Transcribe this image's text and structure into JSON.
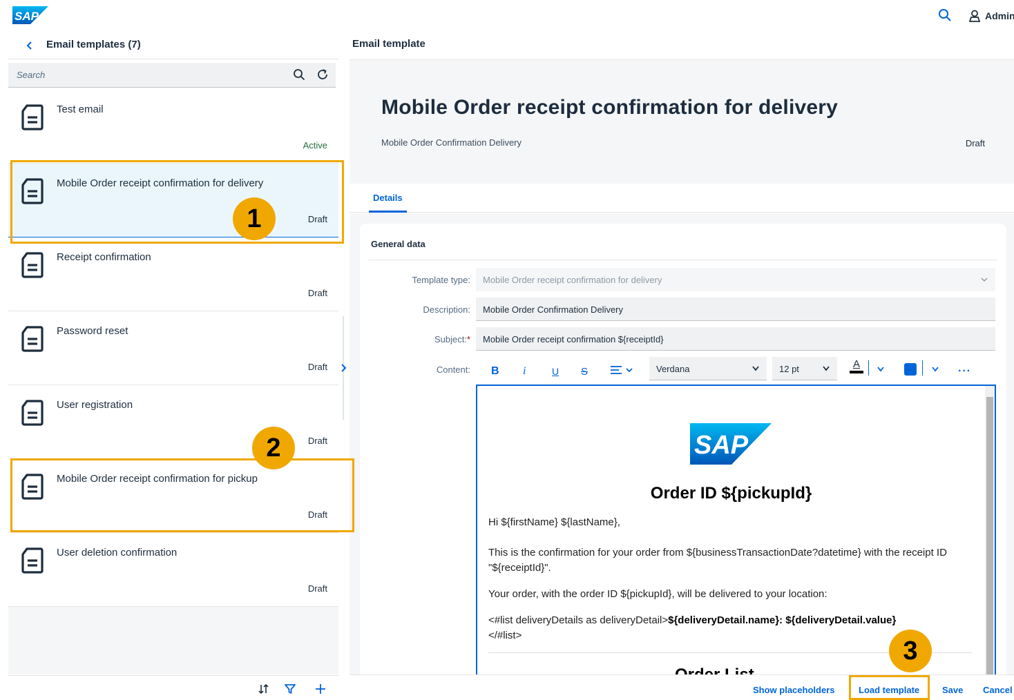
{
  "shell": {
    "logo_text": "SAP",
    "user_label": "Admin"
  },
  "left": {
    "title": "Email templates (7)",
    "search_placeholder": "Search",
    "items": [
      {
        "title": "Test email",
        "status": "Active"
      },
      {
        "title": "Mobile Order receipt confirmation for delivery",
        "status": "Draft"
      },
      {
        "title": "Receipt confirmation",
        "status": "Draft"
      },
      {
        "title": "Password reset",
        "status": "Draft"
      },
      {
        "title": "User registration",
        "status": "Draft"
      },
      {
        "title": "Mobile Order receipt confirmation for pickup",
        "status": "Draft"
      },
      {
        "title": "User deletion confirmation",
        "status": "Draft"
      }
    ]
  },
  "right": {
    "header_title": "Email template",
    "title": "Mobile Order receipt confirmation for delivery",
    "subtitle": "Mobile Order Confirmation Delivery",
    "status": "Draft",
    "tab": "Details",
    "section_title": "General data",
    "form": {
      "template_type_label": "Template type:",
      "template_type_value": "Mobile Order receipt confirmation for delivery",
      "description_label": "Description:",
      "description_value": "Mobile Order Confirmation Delivery",
      "subject_label": "Subject:",
      "subject_required": "*",
      "subject_value": "Mobile Order receipt confirmation ${receiptId}",
      "content_label": "Content:"
    },
    "toolbar": {
      "bold": "B",
      "italic": "i",
      "underline": "U",
      "strike": "S",
      "font": "Verdana",
      "size": "12 pt",
      "font_color_glyph": "A",
      "more": "···",
      "highlight_color": "#0064d9"
    },
    "editor": {
      "logo_text": "SAP",
      "heading": "Order ID ${pickupId}",
      "greeting": "Hi ${firstName} ${lastName},",
      "line1": "This is the confirmation for your order from ${businessTransactionDate?datetime} with the receipt ID \"${receiptId}\".",
      "line2": "Your order, with the order ID ${pickupId}, will be delivered to your location:",
      "list_open": "<#list deliveryDetails as deliveryDetail>",
      "list_bold": "${deliveryDetail.name}: ${deliveryDetail.value}",
      "list_close": "</#list>",
      "cut_heading": "Order List"
    },
    "footer": {
      "show_placeholders": "Show placeholders",
      "load_template": "Load template",
      "save": "Save",
      "cancel": "Cancel"
    }
  },
  "annotations": {
    "badge1": "1",
    "badge2": "2",
    "badge3": "3",
    "color": "#f0a800"
  }
}
